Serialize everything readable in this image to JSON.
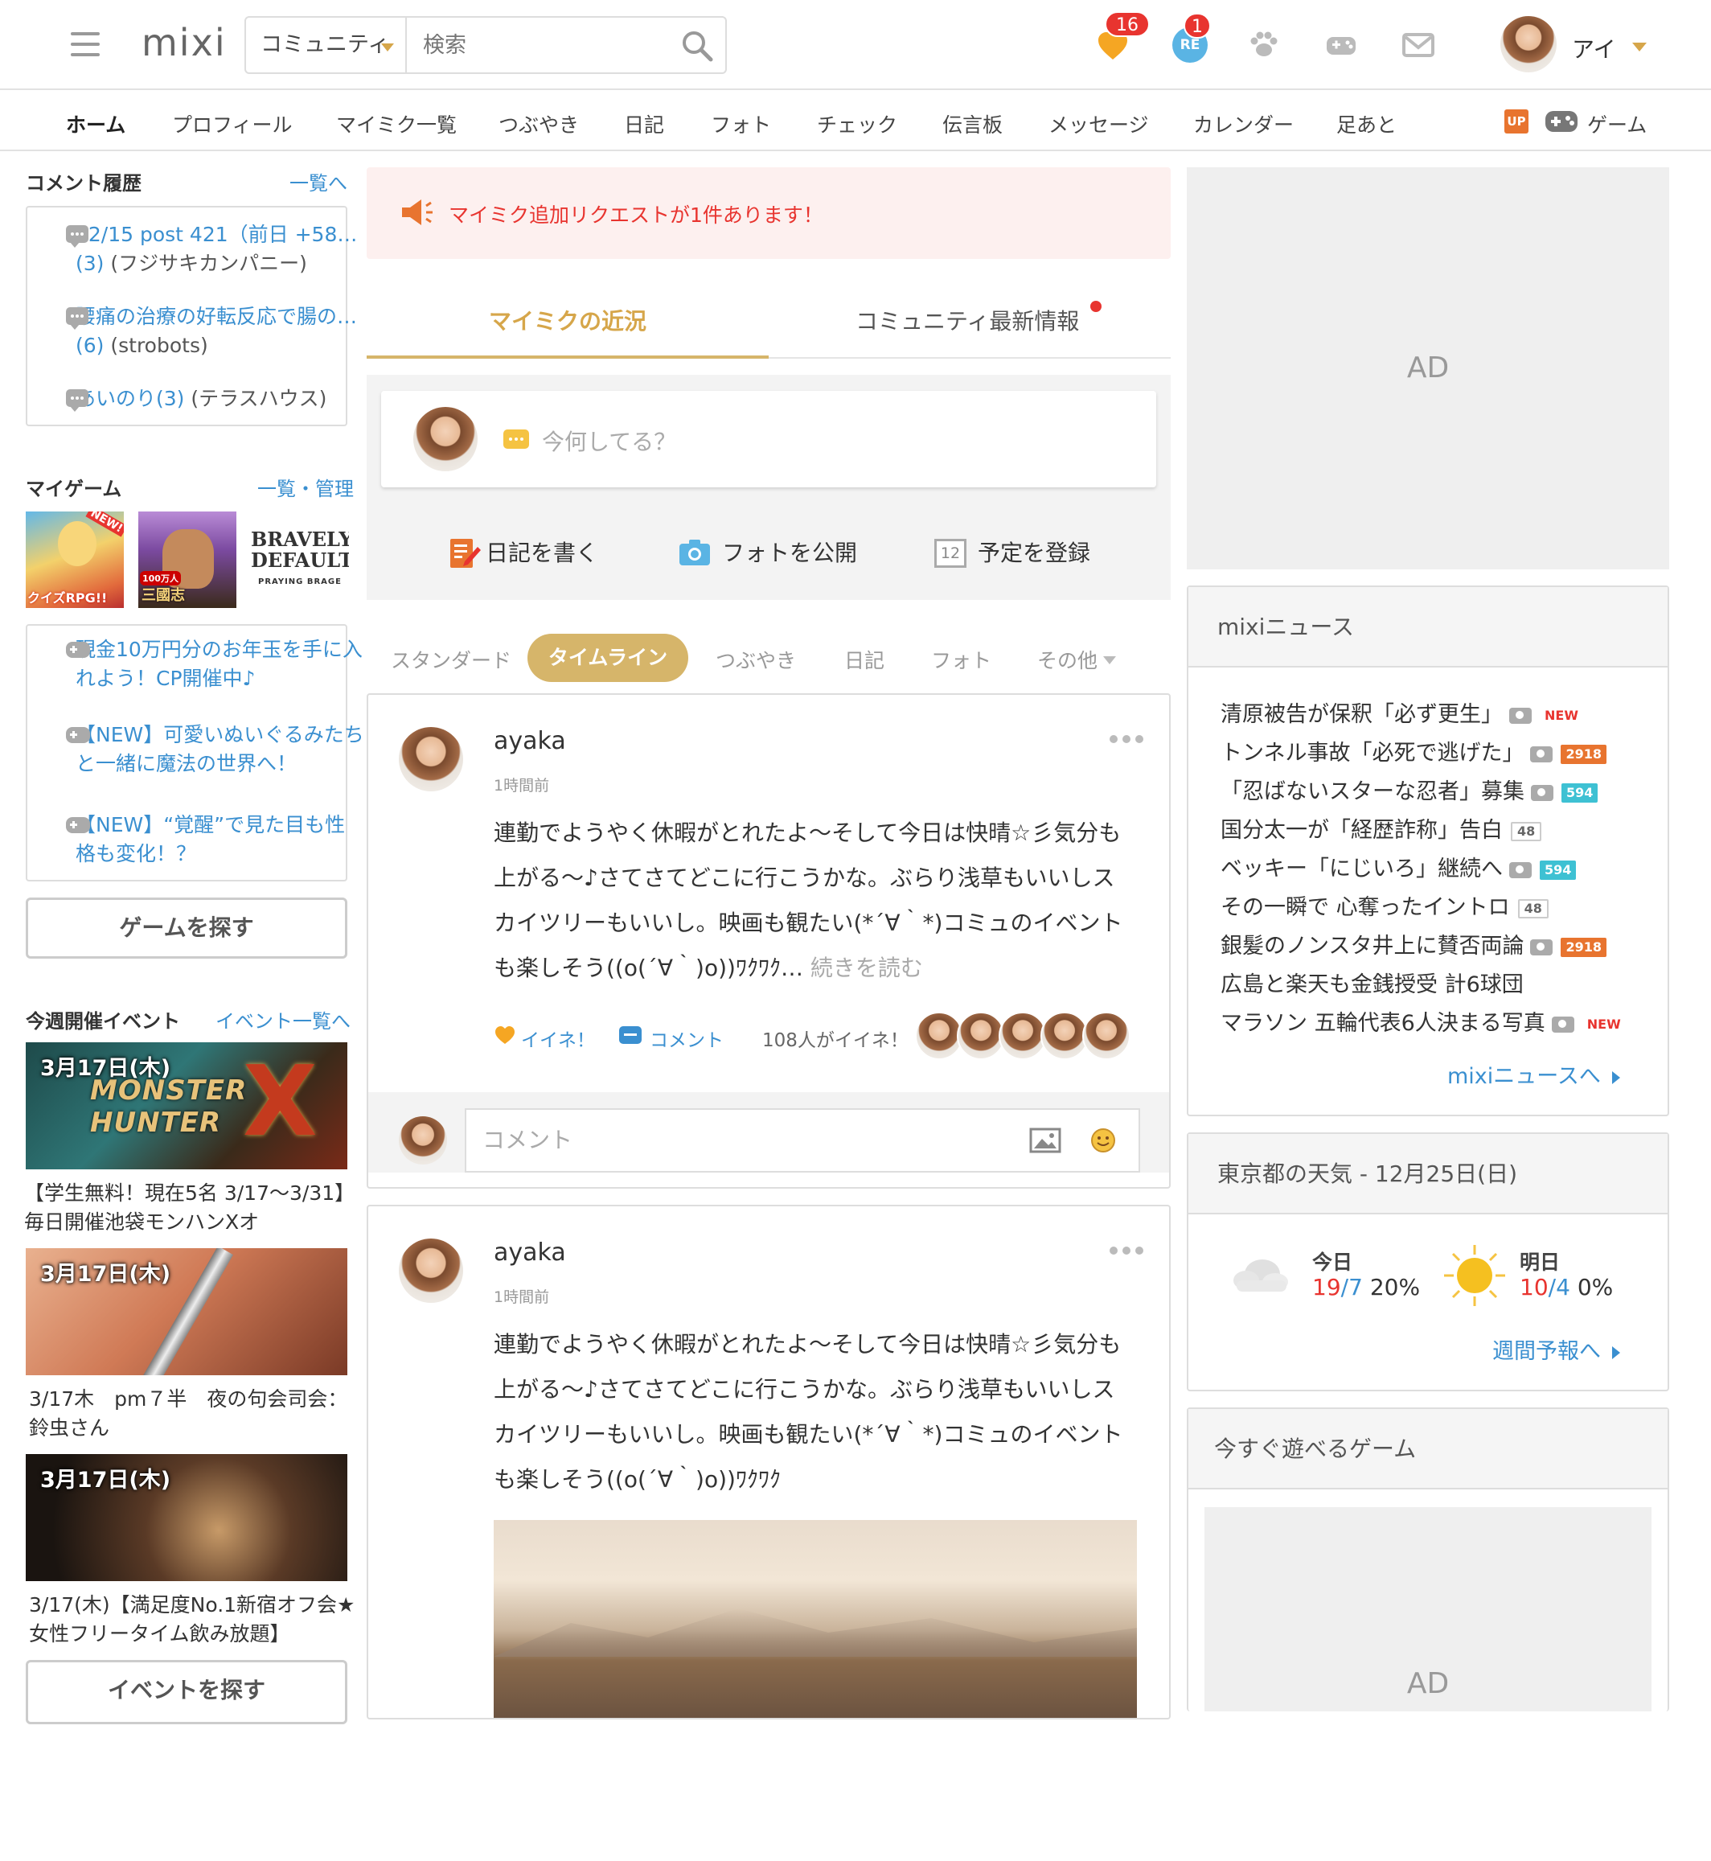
{
  "header": {
    "logo": "mixi",
    "search_category": "コミュニティ",
    "search_placeholder": "検索",
    "notifications": {
      "iine_count": "16",
      "reply_count": "1",
      "reply_icon_label": "RE"
    },
    "user_name": "アイ"
  },
  "nav": {
    "items": [
      "ホーム",
      "プロフィール",
      "マイミク一覧",
      "つぶやき",
      "日記",
      "フォト",
      "チェック",
      "伝言板",
      "メッセージ",
      "カレンダー",
      "足あと"
    ],
    "up_badge": "UP",
    "game": "ゲーム"
  },
  "left": {
    "comments": {
      "title": "コメント履歴",
      "link": "一覧へ",
      "items": [
        {
          "link": "12/15 post 421（前日 +58…(3)",
          "source": "(フジサキカンパニー)"
        },
        {
          "link": "腰痛の治療の好転反応で腸の…(6)",
          "source": "(strobots)"
        },
        {
          "link": "あいのり(3)",
          "source": "(テラスハウス)"
        }
      ]
    },
    "mygame": {
      "title": "マイゲーム",
      "link": "一覧・管理",
      "thumbs": [
        "クイズRPG!!",
        "三國志",
        "BRAVELY DEFAULT"
      ],
      "thumb_new": "NEW!",
      "thumb_sub": "PRAYING BRAGE",
      "thumb_badge": "100万人",
      "news": [
        "現金10万円分のお年玉を手に入れよう！CP開催中♪",
        "【NEW】可愛いぬいぐるみたちと一緒に魔法の世界へ！",
        "【NEW】“覚醒”で見た目も性格も変化！？"
      ],
      "button": "ゲームを探す"
    },
    "events": {
      "title": "今週開催イベント",
      "link": "イベント一覧へ",
      "items": [
        {
          "date": "3月17日(木)",
          "image_text": "MONSTER HUNTER",
          "image_x": "X",
          "text": "【学生無料！現在5名 3/17〜3/31】毎日開催池袋モンハンXオ"
        },
        {
          "date": "3月17日(木)",
          "text": "3/17木　pm７半　夜の句会司会：鈴虫さん"
        },
        {
          "date": "3月17日(木)",
          "text": "3/17(木)【満足度No.1新宿オフ会★女性フリータイム飲み放題】"
        }
      ],
      "button": "イベントを探す"
    }
  },
  "center": {
    "notice": "マイミク追加リクエストが1件あります！",
    "tabs": [
      "マイミクの近況",
      "コミュニティ最新情報"
    ],
    "composer": {
      "placeholder": "今何してる？",
      "actions": [
        "日記を書く",
        "フォトを公開",
        "予定を登録"
      ],
      "calendar_day": "12"
    },
    "filters": [
      "スタンダード",
      "タイムライン",
      "つぶやき",
      "日記",
      "フォト",
      "その他"
    ],
    "posts": [
      {
        "author": "ayaka",
        "time": "1時間前",
        "body": "連勤でようやく休暇がとれたよ〜そして今日は快晴☆彡気分も上がる〜♪さてさてどこに行こうかな。ぶらり浅草もいいしスカイツリーもいいし。映画も観たい(*´∀｀*)コミュのイベントも楽しそう((o(´∀｀)o))ﾜｸﾜｸ…",
        "read_more": "続きを読む",
        "like": "イイネ！",
        "comment": "コメント",
        "likes_count": "108人がイイネ！",
        "comment_placeholder": "コメント"
      },
      {
        "author": "ayaka",
        "time": "1時間前",
        "body": "連勤でようやく休暇がとれたよ〜そして今日は快晴☆彡気分も上がる〜♪さてさてどこに行こうかな。ぶらり浅草もいいしスカイツリーもいいし。映画も観たい(*´∀｀*)コミュのイベントも楽しそう((o(´∀｀)o))ﾜｸﾜｸ"
      }
    ]
  },
  "right": {
    "ad_label": "AD",
    "news": {
      "title": "mixiニュース",
      "items": [
        {
          "text": "清原被告が保釈「必ず更生」",
          "photo": true,
          "badge": "NEW",
          "badge_type": "new"
        },
        {
          "text": "トンネル事故「必死で逃げた」",
          "photo": true,
          "badge": "2918",
          "badge_type": "red"
        },
        {
          "text": "「忍ばないスターな忍者」募集",
          "photo": true,
          "badge": "594",
          "badge_type": "teal"
        },
        {
          "text": "国分太一が「経歴詐称」告白",
          "photo": false,
          "badge": "48",
          "badge_type": "gray"
        },
        {
          "text": "ベッキー「にじいろ」継続へ",
          "photo": true,
          "badge": "594",
          "badge_type": "teal"
        },
        {
          "text": "その一瞬で 心奪ったイントロ",
          "photo": false,
          "badge": "48",
          "badge_type": "gray"
        },
        {
          "text": "銀髪のノンスタ井上に賛否両論",
          "photo": true,
          "badge": "2918",
          "badge_type": "red"
        },
        {
          "text": "広島と楽天も金銭授受 計6球団",
          "photo": false,
          "badge": "",
          "badge_type": ""
        },
        {
          "text": "マラソン 五輪代表6人決まる写真",
          "photo": true,
          "badge": "NEW",
          "badge_type": "new"
        }
      ],
      "link": "mixiニュースへ"
    },
    "weather": {
      "title": "東京都の天気 - 12月25日(日)",
      "today": {
        "label": "今日",
        "high": "19",
        "low": "7",
        "rain": "20%"
      },
      "tomorrow": {
        "label": "明日",
        "high": "10",
        "low": "4",
        "rain": "0%"
      },
      "link": "週間予報へ"
    },
    "games": {
      "title": "今すぐ遊べるゲーム"
    }
  },
  "colors": {
    "accent": "#d6b56a",
    "link": "#3a8fd0",
    "alert": "#e8342f"
  }
}
